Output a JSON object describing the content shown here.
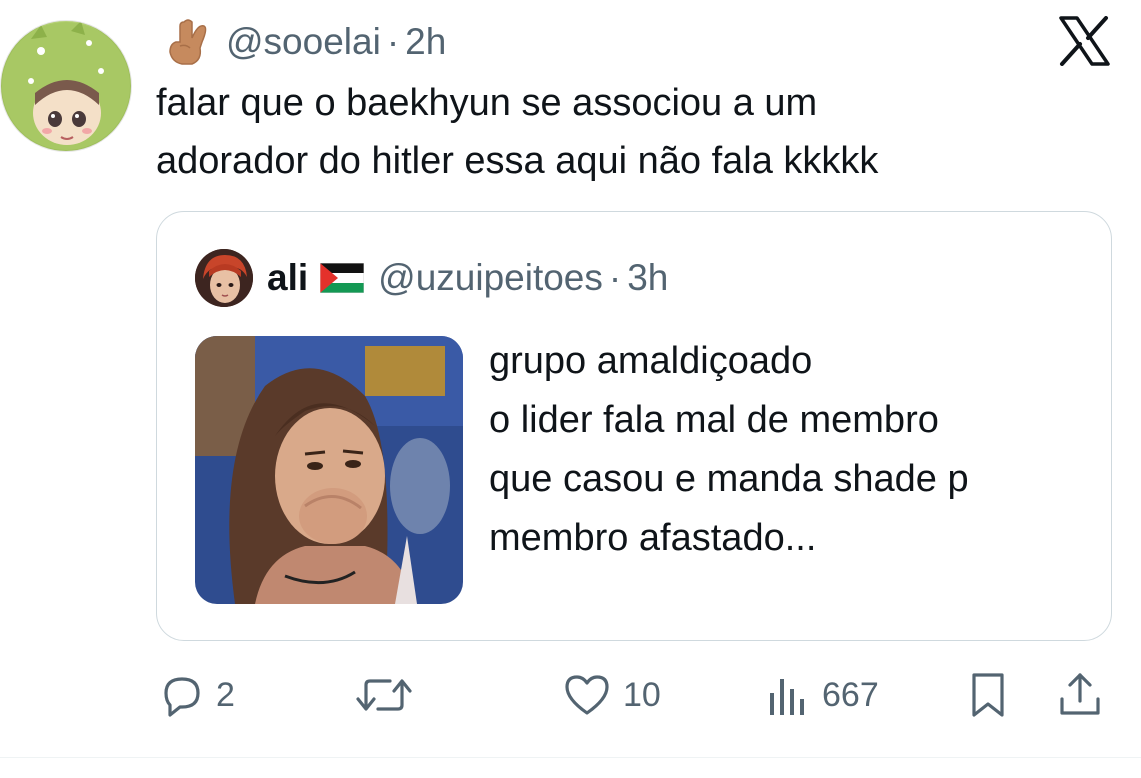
{
  "tweet": {
    "handle": "@sooelai",
    "separator": "·",
    "time": "2h",
    "text": "falar que o baekhyun se associou a um\nadorador do hitler essa aqui não fala kkkkk"
  },
  "quote": {
    "name": "ali",
    "handle": "@uzuipeitoes",
    "separator": "·",
    "time": "3h",
    "text": "grupo amaldiçoado\no lider fala mal de membro\nque casou e manda shade p\nmembro afastado..."
  },
  "actions": {
    "replies": "2",
    "retweets": "",
    "likes": "10",
    "views": "667"
  },
  "colors": {
    "text_primary": "#0f1419",
    "text_secondary": "#536471",
    "border": "#cfd9de"
  },
  "icons": {
    "reply": "reply-icon",
    "retweet": "retweet-icon",
    "like": "heart-icon",
    "views": "views-icon",
    "bookmark": "bookmark-icon",
    "share": "share-icon",
    "platform": "x-logo-icon"
  }
}
